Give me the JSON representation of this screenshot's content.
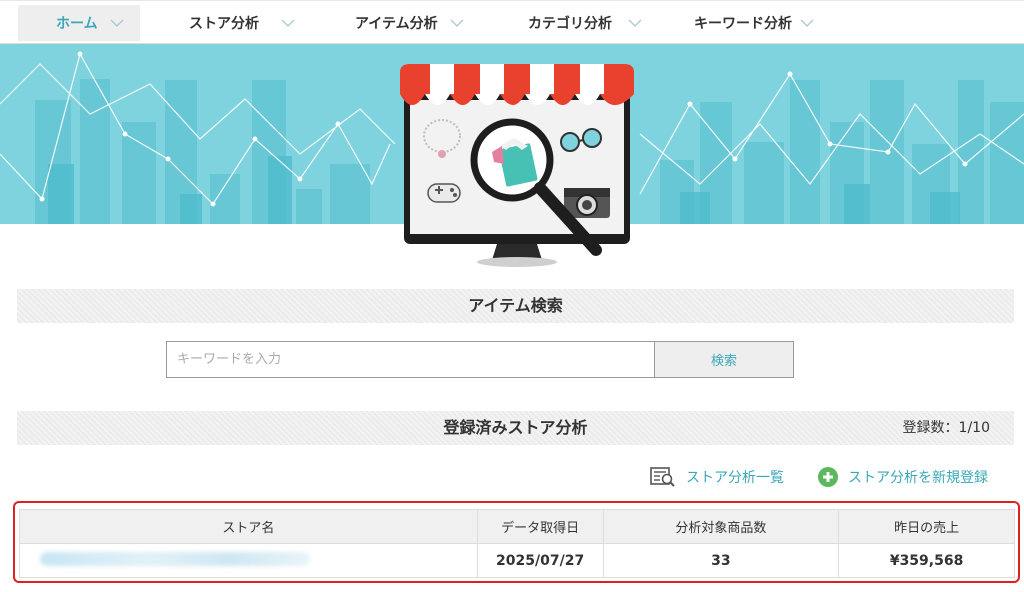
{
  "nav": {
    "items": [
      {
        "label": "ホーム",
        "active": true
      },
      {
        "label": "ストア分析",
        "active": false
      },
      {
        "label": "アイテム分析",
        "active": false
      },
      {
        "label": "カテゴリ分析",
        "active": false
      },
      {
        "label": "キーワード分析",
        "active": false
      }
    ]
  },
  "item_search": {
    "title": "アイテム検索",
    "placeholder": "キーワードを入力",
    "button_label": "検索"
  },
  "store_analysis": {
    "title": "登録済みストア分析",
    "count_label": "登録数：1/10",
    "list_link": "ストア分析一覧",
    "new_link": "ストア分析を新規登録",
    "table": {
      "headers": [
        "ストア名",
        "データ取得日",
        "分析対象商品数",
        "昨日の売上"
      ],
      "rows": [
        {
          "store": "",
          "date": "2025/07/27",
          "items": "33",
          "sales": "¥359,568"
        }
      ]
    }
  },
  "colors": {
    "accent": "#3aa8b8",
    "hero": "#7fd3de",
    "highlight_border": "#e02020",
    "add_icon": "#5cb85c"
  }
}
